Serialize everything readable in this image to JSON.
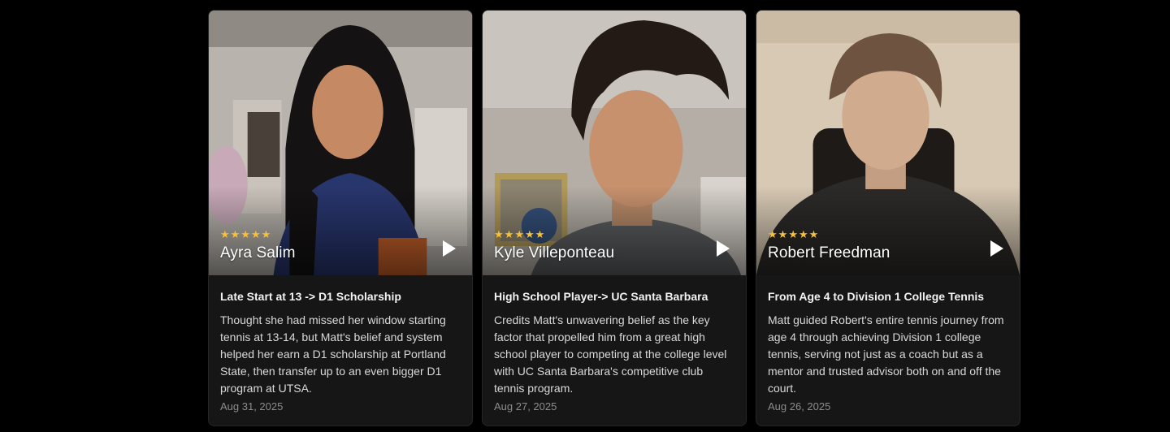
{
  "testimonials": [
    {
      "rating_stars": 5,
      "name": "Ayra Salim",
      "title": "Late Start at 13 -> D1 Scholarship",
      "description": "Thought she had missed her window starting tennis at 13-14, but Matt's belief and system helped her earn a D1 scholarship at Portland State, then transfer up to an even bigger D1 program at UTSA.",
      "date": "Aug 31, 2025"
    },
    {
      "rating_stars": 5,
      "name": "Kyle Villeponteau",
      "title": "High School Player-> UC Santa Barbara",
      "description": "Credits Matt's unwavering belief as the key factor that propelled him from a great high school player to competing at the college level with UC Santa Barbara's competitive club tennis program.",
      "date": "Aug 27, 2025"
    },
    {
      "rating_stars": 5,
      "name": "Robert Freedman",
      "title": "From Age 4 to Division 1 College Tennis",
      "description": "Matt guided Robert's entire tennis journey from age 4 through achieving Division 1 college tennis, serving not just as a coach but as a mentor and trusted advisor both on and off the court.",
      "date": "Aug 26, 2025"
    }
  ],
  "icons": {
    "star": "star-icon",
    "play": "play-icon"
  },
  "colors": {
    "page_background": "#000000",
    "card_background": "#161616",
    "star": "#f5c03c",
    "date_text": "#8c8c8c"
  }
}
